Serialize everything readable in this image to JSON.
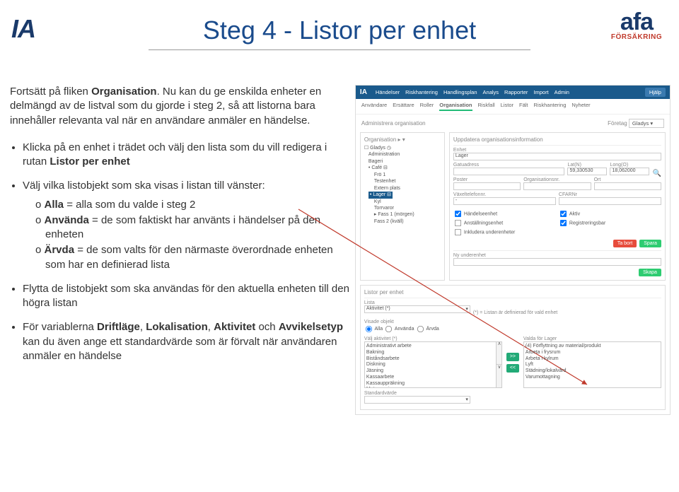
{
  "logo_ia": "IA",
  "logo_afa": "afa",
  "logo_afa_sub": "FÖRSÄKRING",
  "title": "Steg 4 - Listor per enhet",
  "intro_a": "Fortsätt på fliken ",
  "intro_b": "Organisation",
  "intro_c": ". Nu kan du ge enskilda enheter en delmängd av de listval som du gjorde i steg 2, så att listorna bara innehåller relevanta val när en användare anmäler en händelse.",
  "b1a": "Klicka på en enhet i trädet och välj den lista som du vill redigera i rutan ",
  "b1b": "Listor per enhet",
  "b2": "Välj vilka listobjekt som ska visas i listan till vänster:",
  "s1a": "Alla",
  "s1b": " = alla som du valde i steg 2",
  "s2a": "Använda",
  "s2b": " = de som faktiskt har använts i händelser på den enheten",
  "s3a": "Ärvda",
  "s3b": " = de som valts för den närmaste överordnade enheten som har en definierad lista",
  "b3": "Flytta de listobjekt som ska användas för den aktuella enheten till den högra listan",
  "b4a": "För variablerna ",
  "b4b": "Driftläge",
  "b4c": ", ",
  "b4d": "Lokalisation",
  "b4e": ", ",
  "b4f": "Aktivitet",
  "b4g": " och ",
  "b4h": "Avvikelsetyp",
  "b4i": " kan du även ange ett standardvärde som är förvalt när användaren anmäler en händelse",
  "app": {
    "brand": "IA",
    "menu": [
      "Händelser",
      "Riskhantering",
      "Handlingsplan",
      "Analys",
      "Rapporter",
      "Import",
      "Admin"
    ],
    "help": "Hjälp",
    "submenu": [
      "Användare",
      "Ersättare",
      "Roller",
      "Organisation",
      "Riskfall",
      "Listor",
      "Fält",
      "Riskhantering",
      "Nyheter"
    ],
    "submenu_active": 3,
    "bread": "Administrera organisation",
    "company_label": "Företag",
    "company": "Gladys",
    "org_label": "Organisation ▸ ▾",
    "info_label": "Uppdatera organisationsinformation",
    "tree": [
      {
        "lvl": 0,
        "t": "☐ Gladys ◷"
      },
      {
        "lvl": 1,
        "t": "Administration"
      },
      {
        "lvl": 1,
        "t": "Bageri"
      },
      {
        "lvl": 1,
        "t": "• Café ⊟"
      },
      {
        "lvl": 2,
        "t": "Frö 1"
      },
      {
        "lvl": 2,
        "t": "Testenhet"
      },
      {
        "lvl": 2,
        "t": "Extern plats"
      },
      {
        "lvl": 1,
        "t": "• Lager ⊟",
        "sel": true
      },
      {
        "lvl": 2,
        "t": "Kyl"
      },
      {
        "lvl": 2,
        "t": "Torrvaror"
      },
      {
        "lvl": 2,
        "t": "▸ Fass 1 (mörgen)"
      },
      {
        "lvl": 2,
        "t": "Fass 2 (kväll)"
      }
    ],
    "enhet_label": "Enhet",
    "enhet": "Lager",
    "gatu_label": "Gatuadress",
    "lat_label": "Lat(N)",
    "lat": "59,330530",
    "long_label": "Long(O)",
    "long": "18,062000",
    "poster_label": "Poster",
    "orgnr_label": "Organisationsnr.",
    "ort_label": "Ort",
    "vtel_label": "Växeltelefonnr.",
    "cfar_label": "CFARNr",
    "cb1": "Händelseenhet",
    "cb2": "Anställningsenhet",
    "cb3": "Inkludera underenheter",
    "cb4": "Aktiv",
    "cb5": "Registreringsbar",
    "del": "Ta bort",
    "save": "Spara",
    "nyund": "Ny underenhet",
    "create": "Skapa",
    "lists_panel": "Listor per enhet",
    "lista_label": "Lista",
    "lista_val": "Aktivitet (*)",
    "lista_hint": "(*) = Listan är definierad för vald enhet",
    "visade": "Visade objekt",
    "r1": "Alla",
    "r2": "Använda",
    "r3": "Ärvda",
    "left_title": "Välj aktivitet (*)",
    "right_title": "Valda för Lager",
    "left_items": [
      "Administrativt arbete",
      "Bakning",
      "Biståndsarbete",
      "Diskning",
      "Jäsning",
      "Kassaarbete",
      "Kassauppräkning",
      "Matservering"
    ],
    "right_items": [
      "(4) Förflyttning av material/produkt",
      "Arbeta i frysrum",
      "Arbeta i kylrum",
      "Lyft",
      "Städning/lokalvård",
      "Varumottagning"
    ],
    "std_label": "Standardvärde"
  }
}
